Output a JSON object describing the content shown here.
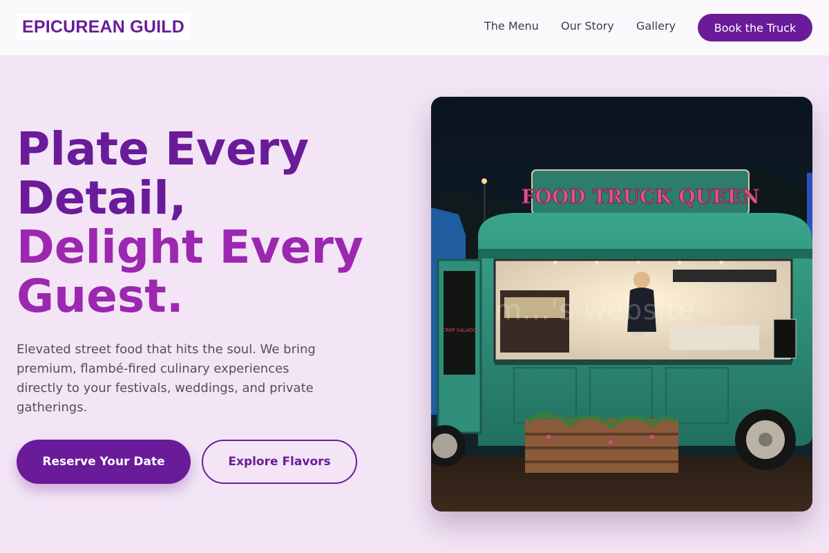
{
  "nav": {
    "logo": "EPICUREAN GUILD",
    "links": [
      "The Menu",
      "Our Story",
      "Gallery"
    ],
    "cta": "Book the Truck"
  },
  "hero": {
    "headline_line1": "Plate Every",
    "headline_line2": "Detail,",
    "headline_line3": "Delight Every",
    "headline_line4": "Guest.",
    "subtext": "Elevated street food that hits the soul. We bring premium, flambé-fired culinary experiences directly to your festivals, weddings, and private gatherings.",
    "primary_button": "Reserve Your Date",
    "secondary_button": "Explore Flavors",
    "image": {
      "sign_text": "FOOD TRUCK QUEEN",
      "watermark": "m...'s website",
      "menu_board_text": "CREP SALADO"
    }
  },
  "colors": {
    "brand_purple": "#6a1b9a",
    "accent_purple": "#9c27b0",
    "background": "#f3e5f5",
    "truck_teal": "#2f8f7a"
  }
}
